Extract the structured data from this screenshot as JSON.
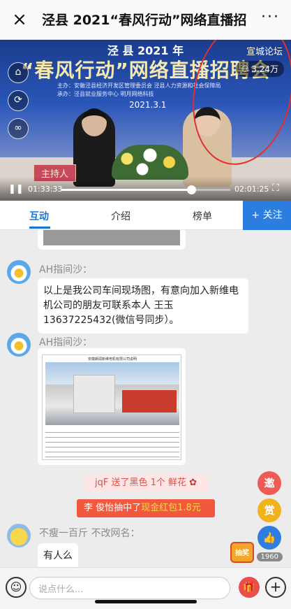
{
  "header": {
    "title": "泾县 2021“春风行动”网络直播招",
    "close_icon": "×",
    "more_icon": "···"
  },
  "video": {
    "banner_line1": "泾 县 2021 年",
    "banner_line2": "“春风行动”网络直播招聘会",
    "organizer": "主办：安徽泾县经济开发区管理委员会   泾县人力资源和社会保障局",
    "organizer2": "承办：泾县就业服务中心   明月网络科技",
    "date": "2021.3.1",
    "forum_label": "宣城论坛",
    "viewers": "3.24万",
    "host_label": "主持人",
    "time_current": "01:33:33",
    "time_total": "02:01:25",
    "progress": 0.77
  },
  "tabs": [
    {
      "label": "互动"
    },
    {
      "label": "介绍"
    },
    {
      "label": "榜单"
    }
  ],
  "follow_label": "+ 关注",
  "messages": {
    "m1_user": "AH指间沙：",
    "m1_text": "以上是我公司车间现场图，有意向加入新维电机公司的朋友可联系本人 王玉13637225432(微信号同步）。",
    "m2_user": "AH指间沙：",
    "doc_title": "安徽朗润新维电机有限公司说明",
    "gift_text": "jqF 送了黑色 1个 鲜花",
    "redpack_prefix": "李 俊怡抽中了",
    "redpack_amount": "现金红包1.8元",
    "m3_user": "不瘦一百斤  不改网名：",
    "m3_text": "有人么"
  },
  "side": {
    "invite": "邀",
    "reward": "赏",
    "like_count": "1960",
    "lottery": "抽奖"
  },
  "input": {
    "placeholder": "说点什么..."
  }
}
